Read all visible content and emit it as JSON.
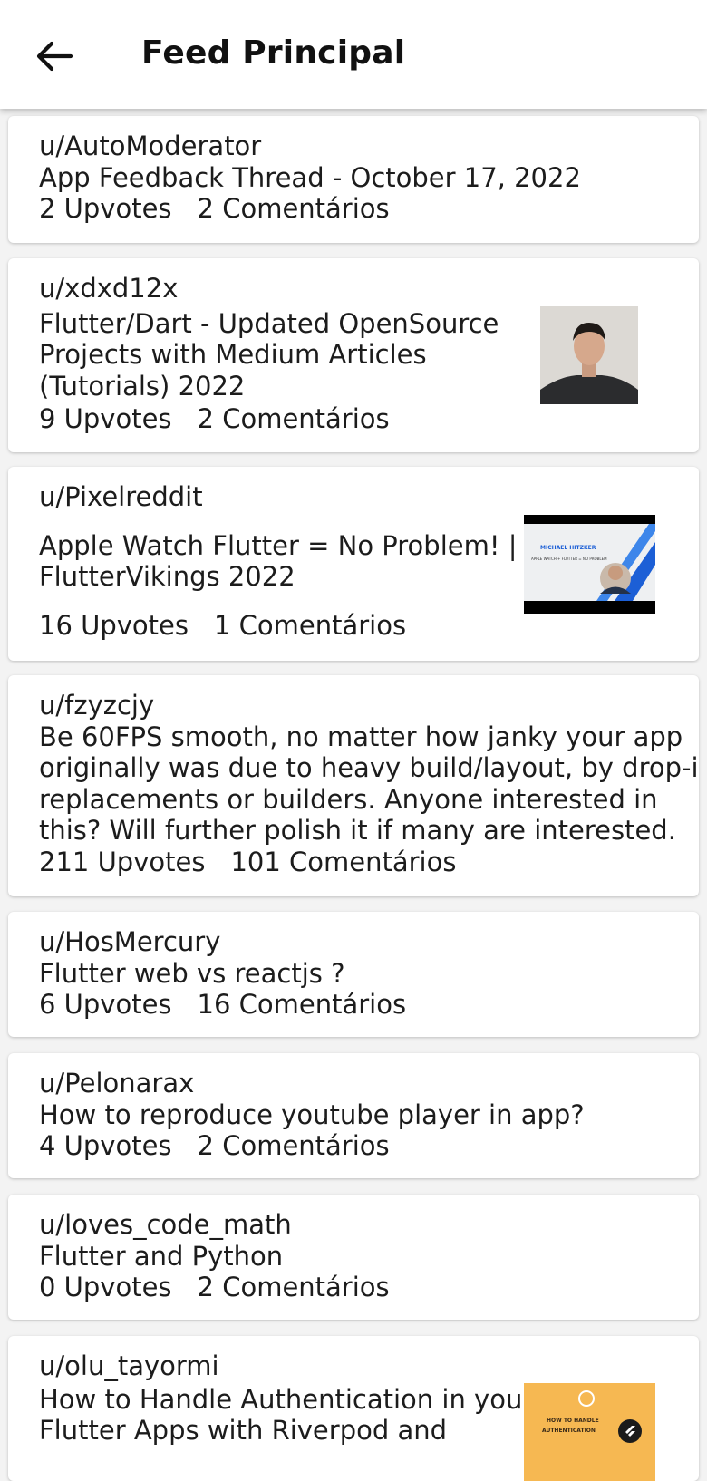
{
  "appbar": {
    "title": "Feed Principal",
    "back_icon": "arrow-left-icon"
  },
  "posts": [
    {
      "author": "u/AutoModerator",
      "title": [
        "App Feedback Thread - October 17, 2022"
      ],
      "upvotes": "2 Upvotes",
      "comments": "2 Comentários"
    },
    {
      "author": "u/xdxd12x",
      "title": [
        "Flutter/Dart - Updated OpenSource",
        "Projects with Medium Articles",
        "(Tutorials) 2022"
      ],
      "upvotes": "9 Upvotes",
      "comments": "2 Comentários",
      "thumbnail": "profile-photo"
    },
    {
      "author": "u/Pixelreddit",
      "title": [
        "Apple Watch Flutter = No Problem! |",
        "FlutterVikings 2022"
      ],
      "upvotes": "16 Upvotes",
      "comments": "1 Comentários",
      "thumbnail": "video-thumbnail",
      "thumb_text": [
        "MICHAEL HITZKER",
        "APPLE WATCH + FLUTTER = NO PROBLEM"
      ]
    },
    {
      "author": "u/fzyzcjy",
      "title": [
        "Be 60FPS smooth, no matter how janky your app",
        "originally was due to heavy build/layout, by drop-in",
        "replacements or builders. Anyone interested in",
        "this? Will further polish it if many are interested."
      ],
      "upvotes": "211 Upvotes",
      "comments": "101 Comentários"
    },
    {
      "author": "u/HosMercury",
      "title": [
        "Flutter web vs reactjs ?"
      ],
      "upvotes": "6 Upvotes",
      "comments": "16 Comentários"
    },
    {
      "author": "u/Pelonarax",
      "title": [
        "How to reproduce youtube player in app?"
      ],
      "upvotes": "4 Upvotes",
      "comments": "2 Comentários"
    },
    {
      "author": "u/loves_code_math",
      "title": [
        "Flutter and Python"
      ],
      "upvotes": "0 Upvotes",
      "comments": "2 Comentários"
    },
    {
      "author": "u/olu_tayormi",
      "title": [
        "How to Handle Authentication in your",
        "Flutter Apps with Riverpod and"
      ],
      "upvotes": "",
      "comments": "",
      "thumbnail": "article-thumbnail",
      "thumb_text": [
        "HOW TO HANDLE",
        "AUTHENTICATION"
      ]
    }
  ]
}
